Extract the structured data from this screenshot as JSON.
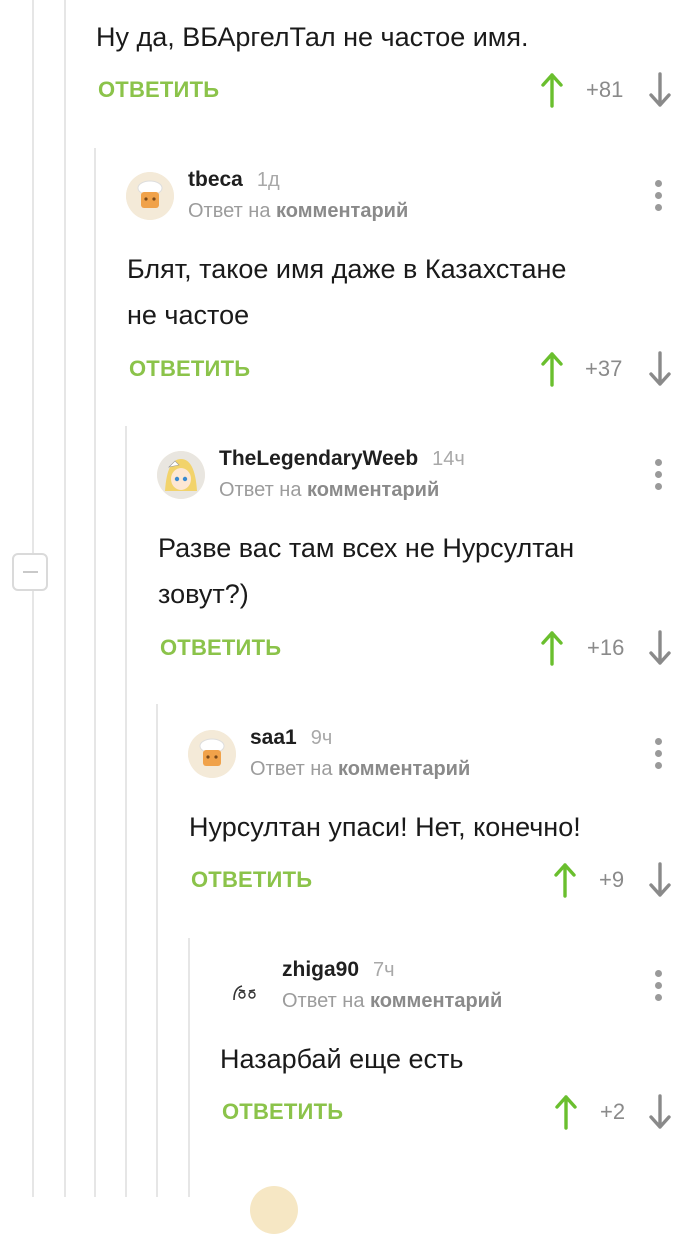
{
  "reply_to": {
    "prefix": "Ответ на",
    "link": "комментарий"
  },
  "top_comment": {
    "text": "Ну да, ВБАргелТал не частое имя.",
    "reply_label": "ОТВЕТИТЬ",
    "score": "+81"
  },
  "comments": [
    {
      "author": "tbeca",
      "time": "1д",
      "text_lines": [
        "Блят, такое имя даже в Казахстане",
        "не частое"
      ],
      "reply_label": "ОТВЕТИТЬ",
      "score": "+37"
    },
    {
      "author": "TheLegendaryWeeb",
      "time": "14ч",
      "text_lines": [
        "Разве вас там всех не Нурсултан",
        "зовут?)"
      ],
      "reply_label": "ОТВЕТИТЬ",
      "score": "+16"
    },
    {
      "author": "saa1",
      "time": "9ч",
      "text_lines": [
        "Нурсултан упаси! Нет, конечно!"
      ],
      "reply_label": "ОТВЕТИТЬ",
      "score": "+9"
    },
    {
      "author": "zhiga90",
      "time": "7ч",
      "text_lines": [
        "Назарбай еще есть"
      ],
      "reply_label": "ОТВЕТИТЬ",
      "score": "+2"
    }
  ],
  "colors": {
    "accent_green": "#8bc34a",
    "upvote_green": "#6abf2e",
    "muted": "#9c9c9c",
    "thread_line": "#e6e6e6"
  },
  "icons": [
    "collapse-minus-icon",
    "upvote-arrow-icon",
    "downvote-arrow-icon",
    "more-vertical-icon",
    "chef-avatar-icon",
    "anime-avatar-icon",
    "face-avatar-icon"
  ]
}
